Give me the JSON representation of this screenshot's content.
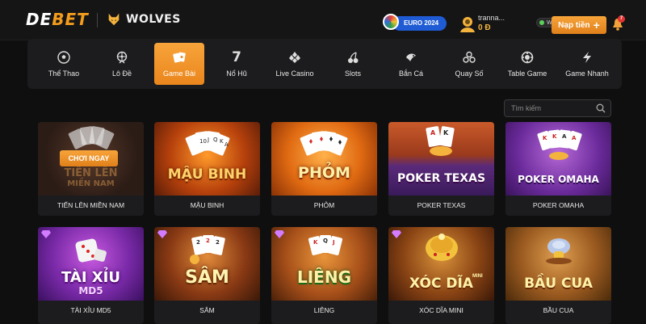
{
  "header": {
    "logo_prefix": "DE",
    "logo_suffix": "BET",
    "partner": "WOLVES",
    "euro_label": "EURO 2024",
    "username": "tranna...",
    "balance": "0 Đ",
    "rank": "Warrior",
    "deposit_label": "Nạp tiền",
    "notification_count": "7"
  },
  "categories": [
    {
      "label": "Thể Thao",
      "icon": "soccer-ball-icon"
    },
    {
      "label": "Lô Đề",
      "icon": "lottery-wheel-icon"
    },
    {
      "label": "Game Bài",
      "icon": "playing-cards-icon",
      "active": true
    },
    {
      "label": "Nổ Hũ",
      "icon": "slot-seven-icon"
    },
    {
      "label": "Live Casino",
      "icon": "diamond-suit-icon"
    },
    {
      "label": "Slots",
      "icon": "cherries-icon"
    },
    {
      "label": "Bắn Cá",
      "icon": "fish-icon"
    },
    {
      "label": "Quay Số",
      "icon": "lottery-balls-icon"
    },
    {
      "label": "Table Game",
      "icon": "casino-chip-icon"
    },
    {
      "label": "Game Nhanh",
      "icon": "lightning-icon"
    }
  ],
  "search": {
    "placeholder": "Tìm kiếm"
  },
  "play_label": "CHƠI NGAY",
  "games": [
    {
      "name": "TIẾN LÊN MIỀN NAM",
      "art_title": "TIẾN LÊN",
      "art_subtitle": "MIỀN NAM"
    },
    {
      "name": "MẬU BINH",
      "art_title": "MẬU BINH"
    },
    {
      "name": "PHỎM",
      "art_title": "PHỎM"
    },
    {
      "name": "POKER TEXAS",
      "art_title": "POKER TEXAS"
    },
    {
      "name": "POKER OMAHA",
      "art_title": "POKER OMAHA"
    },
    {
      "name": "TÀI XỈU MD5",
      "art_title": "TÀI XỈU",
      "art_subtitle": "MD5"
    },
    {
      "name": "SÂM",
      "art_title": "SÂM"
    },
    {
      "name": "LIÊNG",
      "art_title": "LIÊNG"
    },
    {
      "name": "XÓC DĨA MINI",
      "art_title": "XÓC DĨA",
      "art_subtitle": "MINI"
    },
    {
      "name": "BẦU CUA",
      "art_title": "BẦU CUA"
    }
  ],
  "colors": {
    "accent": "#f39c1d",
    "background": "#0f0f10",
    "panel": "#1c1c1e"
  }
}
